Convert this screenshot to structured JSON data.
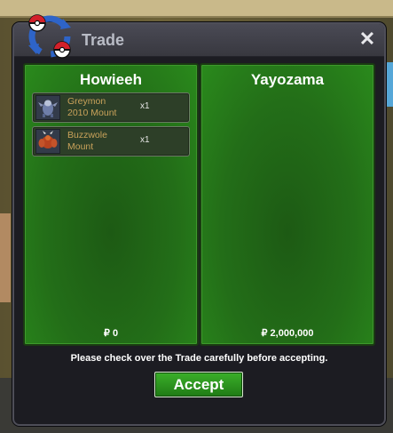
{
  "window": {
    "title": "Trade",
    "close_label": "✕"
  },
  "left_panel": {
    "player": "Howieeh",
    "money": "₽ 0",
    "items": [
      {
        "name_line1": "Greymon",
        "name_line2": "2010 Mount",
        "qty": "x1",
        "icon": "greymon-mount-icon"
      },
      {
        "name_line1": "Buzzwole",
        "name_line2": "Mount",
        "qty": "x1",
        "icon": "buzzwole-mount-icon"
      }
    ]
  },
  "right_panel": {
    "player": "Yayozama",
    "money": "₽ 2,000,000"
  },
  "notice": "Please check over the Trade carefully before accepting.",
  "accept_label": "Accept",
  "colors": {
    "panel_green": "#236e18",
    "accept_green": "#2c9620",
    "item_text": "#c9a25a"
  }
}
